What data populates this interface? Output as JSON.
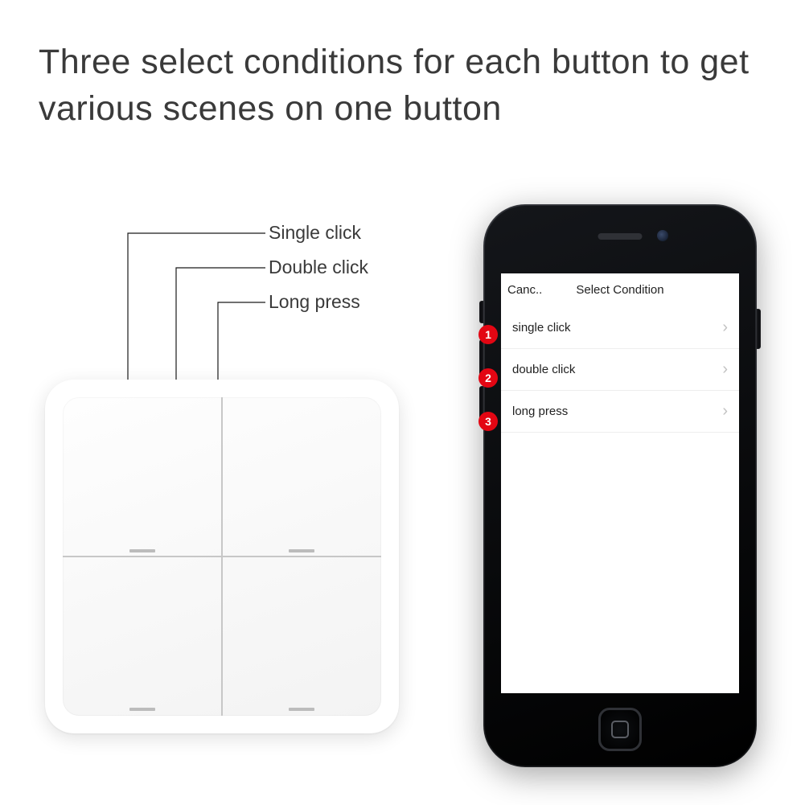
{
  "headline": "Three select conditions for each button to get various scenes on one button",
  "callout_labels": {
    "single": "Single click",
    "double": "Double click",
    "long": "Long press"
  },
  "phone": {
    "nav_cancel": "Canc..",
    "nav_title": "Select Condition",
    "options": [
      {
        "label": "single click"
      },
      {
        "label": "double click"
      },
      {
        "label": "long press"
      }
    ],
    "bullets": [
      "1",
      "2",
      "3"
    ]
  }
}
